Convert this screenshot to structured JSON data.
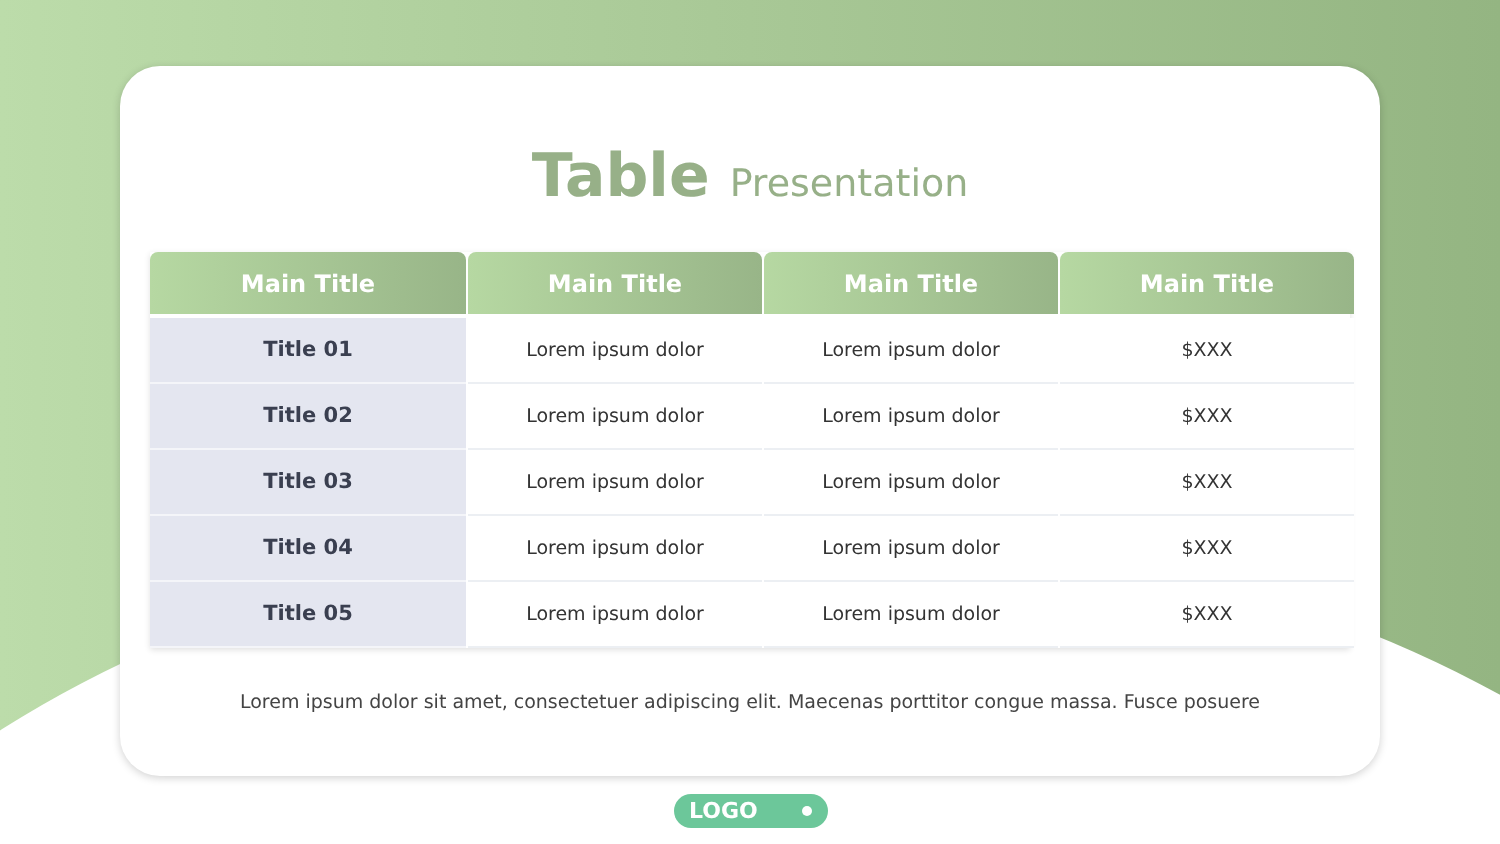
{
  "title": {
    "main": "Table",
    "sub": "Presentation"
  },
  "table": {
    "columns": [
      "Main Title",
      "Main Title",
      "Main Title",
      "Main Title"
    ],
    "rows": [
      {
        "cells": [
          "Title 01",
          "Lorem ipsum dolor",
          "Lorem ipsum dolor",
          "$XXX"
        ]
      },
      {
        "cells": [
          "Title 02",
          "Lorem ipsum dolor",
          "Lorem ipsum dolor",
          "$XXX"
        ]
      },
      {
        "cells": [
          "Title 03",
          "Lorem ipsum dolor",
          "Lorem ipsum dolor",
          "$XXX"
        ]
      },
      {
        "cells": [
          "Title 04",
          "Lorem ipsum dolor",
          "Lorem ipsum dolor",
          "$XXX"
        ]
      },
      {
        "cells": [
          "Title 05",
          "Lorem ipsum dolor",
          "Lorem ipsum dolor",
          "$XXX"
        ]
      }
    ]
  },
  "caption": "Lorem ipsum dolor sit amet, consectetuer adipiscing elit. Maecenas porttitor congue massa. Fusce posuere",
  "logo": "LOGO"
}
